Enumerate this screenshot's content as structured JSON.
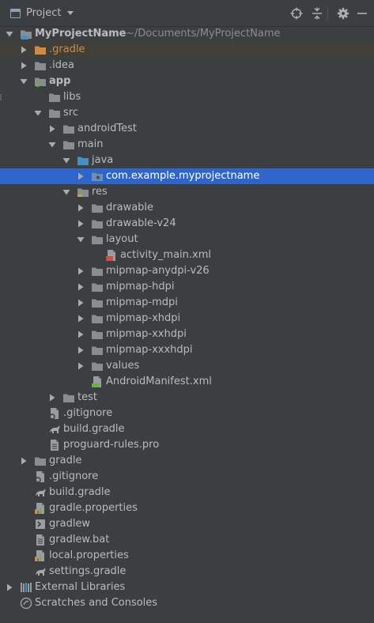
{
  "header": {
    "title": "Project",
    "icons": [
      "project-window-icon",
      "dropdown-arrow-icon",
      "locate-icon",
      "collapse-all-icon",
      "gear-icon",
      "hide-icon"
    ]
  },
  "tree": {
    "rows": [
      {
        "label": "MyProjectName",
        "path": "~/Documents/MyProjectName",
        "icon": "module-folder-icon",
        "arrow": "down",
        "depth": 0,
        "bold": true
      },
      {
        "label": ".gradle",
        "icon": "folder-orange-icon",
        "arrow": "right",
        "depth": 1,
        "orange": true,
        "hl": true
      },
      {
        "label": ".idea",
        "icon": "folder-icon",
        "arrow": "right",
        "depth": 1
      },
      {
        "label": "app",
        "icon": "android-module-icon",
        "arrow": "down",
        "depth": 1,
        "bold": true
      },
      {
        "label": "libs",
        "icon": "folder-icon",
        "arrow": "none",
        "depth": 2
      },
      {
        "label": "src",
        "icon": "folder-icon",
        "arrow": "down",
        "depth": 2
      },
      {
        "label": "androidTest",
        "icon": "folder-icon",
        "arrow": "right",
        "depth": 3
      },
      {
        "label": "main",
        "icon": "folder-icon",
        "arrow": "down",
        "depth": 3
      },
      {
        "label": "java",
        "icon": "source-folder-icon",
        "arrow": "down",
        "depth": 4
      },
      {
        "label": "com.example.myprojectname",
        "icon": "package-icon",
        "arrow": "right",
        "depth": 5,
        "selected": true
      },
      {
        "label": "res",
        "icon": "resource-folder-icon",
        "arrow": "down",
        "depth": 4
      },
      {
        "label": "drawable",
        "icon": "folder-icon",
        "arrow": "right",
        "depth": 5
      },
      {
        "label": "drawable-v24",
        "icon": "folder-icon",
        "arrow": "right",
        "depth": 5
      },
      {
        "label": "layout",
        "icon": "folder-icon",
        "arrow": "down",
        "depth": 5
      },
      {
        "label": "activity_main.xml",
        "icon": "layout-xml-icon",
        "arrow": "none",
        "depth": 6
      },
      {
        "label": "mipmap-anydpi-v26",
        "icon": "folder-icon",
        "arrow": "right",
        "depth": 5
      },
      {
        "label": "mipmap-hdpi",
        "icon": "folder-icon",
        "arrow": "right",
        "depth": 5
      },
      {
        "label": "mipmap-mdpi",
        "icon": "folder-icon",
        "arrow": "right",
        "depth": 5
      },
      {
        "label": "mipmap-xhdpi",
        "icon": "folder-icon",
        "arrow": "right",
        "depth": 5
      },
      {
        "label": "mipmap-xxhdpi",
        "icon": "folder-icon",
        "arrow": "right",
        "depth": 5
      },
      {
        "label": "mipmap-xxxhdpi",
        "icon": "folder-icon",
        "arrow": "right",
        "depth": 5
      },
      {
        "label": "values",
        "icon": "folder-icon",
        "arrow": "right",
        "depth": 5
      },
      {
        "label": "AndroidManifest.xml",
        "icon": "manifest-icon",
        "arrow": "none",
        "depth": 5
      },
      {
        "label": "test",
        "icon": "folder-icon",
        "arrow": "right",
        "depth": 3
      },
      {
        "label": ".gitignore",
        "icon": "gitignore-icon",
        "arrow": "none",
        "depth": 2
      },
      {
        "label": "build.gradle",
        "icon": "gradle-icon",
        "arrow": "none",
        "depth": 2
      },
      {
        "label": "proguard-rules.pro",
        "icon": "text-file-icon",
        "arrow": "none",
        "depth": 2
      },
      {
        "label": "gradle",
        "icon": "folder-icon",
        "arrow": "right",
        "depth": 1
      },
      {
        "label": ".gitignore",
        "icon": "gitignore-icon",
        "arrow": "none",
        "depth": 1
      },
      {
        "label": "build.gradle",
        "icon": "gradle-icon",
        "arrow": "none",
        "depth": 1
      },
      {
        "label": "gradle.properties",
        "icon": "properties-icon",
        "arrow": "none",
        "depth": 1
      },
      {
        "label": "gradlew",
        "icon": "shell-script-icon",
        "arrow": "none",
        "depth": 1
      },
      {
        "label": "gradlew.bat",
        "icon": "text-file-icon",
        "arrow": "none",
        "depth": 1
      },
      {
        "label": "local.properties",
        "icon": "properties-icon",
        "arrow": "none",
        "depth": 1
      },
      {
        "label": "settings.gradle",
        "icon": "gradle-icon",
        "arrow": "none",
        "depth": 1
      },
      {
        "label": "External Libraries",
        "icon": "libraries-icon",
        "arrow": "right",
        "depth": 0
      },
      {
        "label": "Scratches and Consoles",
        "icon": "scratches-icon",
        "arrow": "none",
        "depth": 0
      }
    ]
  },
  "colors": {
    "background": "#3c3f41",
    "selection": "#2f65ca",
    "text": "#bbbbbb",
    "folder": "#8a8d90",
    "source_folder": "#4a8fc1",
    "orange_folder": "#d08a45",
    "android_green": "#68b245"
  }
}
